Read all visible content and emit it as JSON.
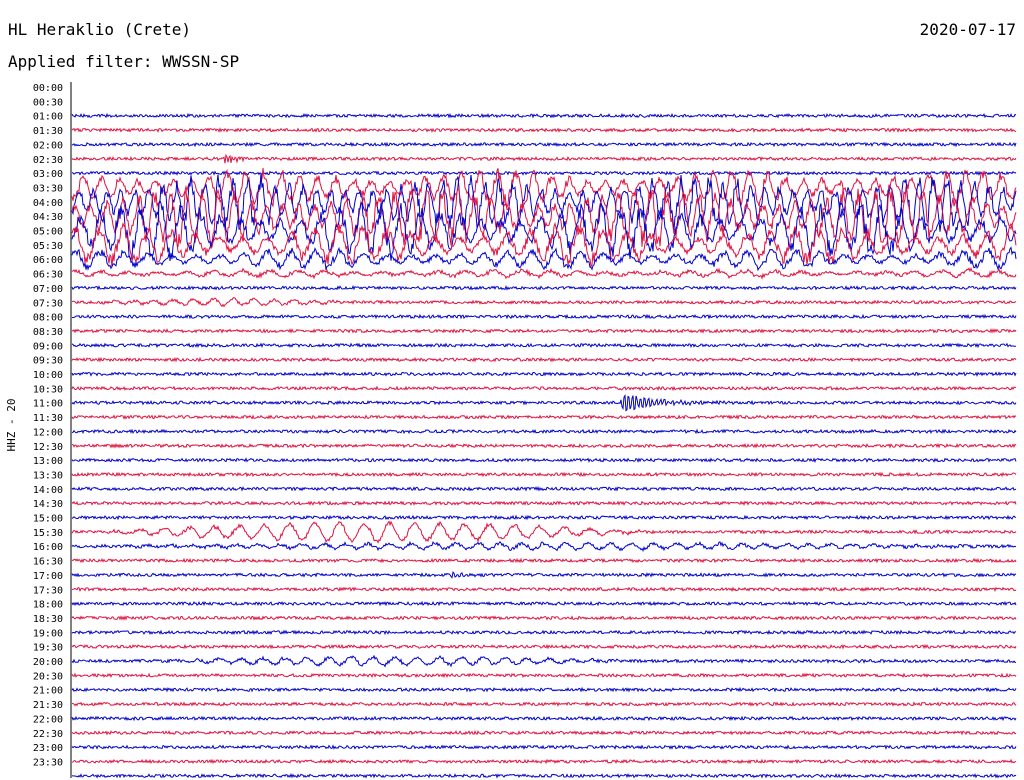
{
  "header": {
    "title": "HL Heraklio (Crete)",
    "date": "2020-07-17",
    "filter": "Applied filter: WWSSN-SP"
  },
  "chart_data": {
    "type": "line",
    "title": "HL Heraklio (Crete)",
    "ylabel": "HHZ - 20",
    "time_labels": [
      "00:00",
      "00:30",
      "01:00",
      "01:30",
      "02:00",
      "02:30",
      "03:00",
      "03:30",
      "04:00",
      "04:30",
      "05:00",
      "05:30",
      "06:00",
      "06:30",
      "07:00",
      "07:30",
      "08:00",
      "08:30",
      "09:00",
      "09:30",
      "10:00",
      "10:30",
      "11:00",
      "11:30",
      "12:00",
      "12:30",
      "13:00",
      "13:30",
      "14:00",
      "14:30",
      "15:00",
      "15:30",
      "16:00",
      "16:30",
      "17:00",
      "17:30",
      "18:00",
      "18:30",
      "19:00",
      "19:30",
      "20:00",
      "20:30",
      "21:00",
      "21:30",
      "22:00",
      "22:30",
      "23:00",
      "23:30"
    ],
    "trace_colors": [
      "#0000cc",
      "#e0103f"
    ],
    "noise_amplitude": 1.5,
    "events": [
      {
        "row": 5,
        "start": 0.16,
        "end": 0.21,
        "amp": 6,
        "period": 3,
        "shape": "burst"
      },
      {
        "row": 7,
        "start": 0.0,
        "end": 1.0,
        "amp": 14,
        "period": 18,
        "shape": "teleseism"
      },
      {
        "row": 8,
        "start": 0.0,
        "end": 1.0,
        "amp": 22,
        "period": 14,
        "shape": "teleseism"
      },
      {
        "row": 9,
        "start": 0.0,
        "end": 1.0,
        "amp": 24,
        "period": 16,
        "shape": "teleseism"
      },
      {
        "row": 10,
        "start": 0.0,
        "end": 1.0,
        "amp": 22,
        "period": 20,
        "shape": "teleseism"
      },
      {
        "row": 11,
        "start": 0.0,
        "end": 1.0,
        "amp": 16,
        "period": 24,
        "shape": "teleseism"
      },
      {
        "row": 12,
        "start": 0.0,
        "end": 1.0,
        "amp": 8,
        "period": 24,
        "shape": "teleseism"
      },
      {
        "row": 13,
        "start": 0.0,
        "end": 1.0,
        "amp": 3,
        "period": 28,
        "shape": "teleseism"
      },
      {
        "row": 15,
        "start": 0.02,
        "end": 0.3,
        "amp": 3,
        "period": 20,
        "shape": "swell"
      },
      {
        "row": 22,
        "start": 0.58,
        "end": 0.7,
        "amp": 12,
        "period": 4,
        "shape": "burst"
      },
      {
        "row": 31,
        "start": 0.03,
        "end": 0.62,
        "amp": 9,
        "period": 25,
        "shape": "swell"
      },
      {
        "row": 32,
        "start": 0.0,
        "end": 1.0,
        "amp": 3,
        "period": 22,
        "shape": "swell"
      },
      {
        "row": 34,
        "start": 0.4,
        "end": 0.44,
        "amp": 3,
        "period": 4,
        "shape": "burst"
      },
      {
        "row": 40,
        "start": 0.08,
        "end": 0.6,
        "amp": 4,
        "period": 22,
        "shape": "swell"
      }
    ]
  }
}
